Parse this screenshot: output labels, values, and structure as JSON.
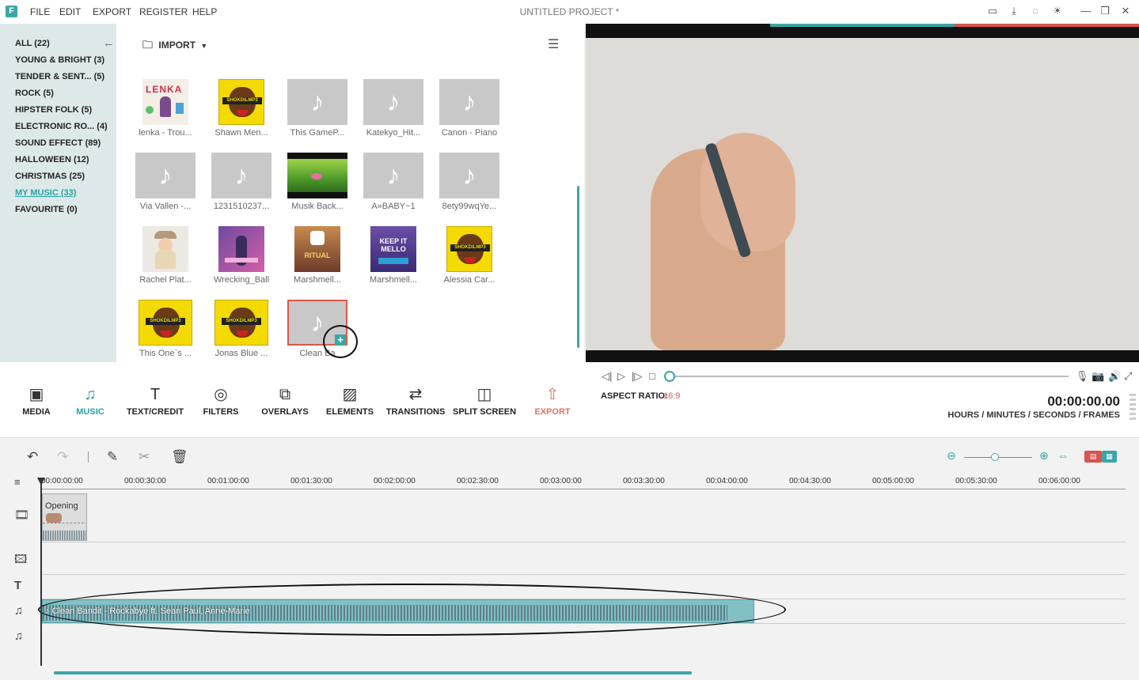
{
  "app": {
    "logo": "F",
    "project_title": "UNTITLED PROJECT *",
    "menu": [
      "FILE",
      "EDIT",
      "EXPORT",
      "REGISTER",
      "HELP"
    ],
    "window_icons": [
      "save-icon",
      "download-icon",
      "feedback-icon",
      "brightness-icon",
      "minimize-icon",
      "restore-icon",
      "close-icon"
    ]
  },
  "categories": [
    {
      "label": "ALL (22)"
    },
    {
      "label": "YOUNG & BRIGHT (3)"
    },
    {
      "label": "TENDER & SENT...  (5)"
    },
    {
      "label": "ROCK (5)"
    },
    {
      "label": "HIPSTER FOLK (5)"
    },
    {
      "label": "ELECTRONIC RO...  (4)"
    },
    {
      "label": "SOUND EFFECT (89)"
    },
    {
      "label": "HALLOWEEN (12)"
    },
    {
      "label": "CHRISTMAS (25)"
    },
    {
      "label": "MY MUSIC (33)",
      "active": true
    },
    {
      "label": "FAVOURITE (0)"
    }
  ],
  "library": {
    "import_label": "IMPORT",
    "items": [
      {
        "caption": "lenka - Trou...",
        "thumb": "lenka"
      },
      {
        "caption": "Shawn Men...",
        "thumb": "bear"
      },
      {
        "caption": "This GameP...",
        "thumb": "note"
      },
      {
        "caption": "Katekyo_Hit...",
        "thumb": "note"
      },
      {
        "caption": "Canon - Piano",
        "thumb": "note"
      },
      {
        "caption": "Via Vallen -...",
        "thumb": "note"
      },
      {
        "caption": "1231510237...",
        "thumb": "note"
      },
      {
        "caption": "Musik Back...",
        "thumb": "nature"
      },
      {
        "caption": "A»BABY~1",
        "thumb": "note"
      },
      {
        "caption": "8ety99wqYe...",
        "thumb": "note"
      },
      {
        "caption": "Rachel Plat...",
        "thumb": "rachel"
      },
      {
        "caption": "Wrecking_Ball",
        "thumb": "wrecking"
      },
      {
        "caption": "Marshmell...",
        "thumb": "ritual"
      },
      {
        "caption": "Marshmell...",
        "thumb": "keepit"
      },
      {
        "caption": "Alessia Car...",
        "thumb": "bear"
      },
      {
        "caption": "This One`s ...",
        "thumb": "bear"
      },
      {
        "caption": "Jonas Blue ...",
        "thumb": "bear"
      },
      {
        "caption": "Clean Ba",
        "thumb": "note",
        "selected": true
      }
    ],
    "bear_text": "SHOKDILMP3",
    "ritual_text": "RITUAL",
    "keepit_text": "KEEP IT MELLO",
    "lenka_text": "LENKA",
    "add_badge": "+"
  },
  "player": {
    "aspect_label": "ASPECT RATIO:",
    "aspect_value": "16:9",
    "timecode": "00:00:00.00",
    "timecode_label": "HOURS / MINUTES / SECONDS / FRAMES",
    "progress": 0
  },
  "toolbar": [
    {
      "label": "MEDIA",
      "icon": "media-icon"
    },
    {
      "label": "MUSIC",
      "icon": "music-icon",
      "active": true
    },
    {
      "label": "TEXT/CREDIT",
      "icon": "text-icon"
    },
    {
      "label": "FILTERS",
      "icon": "filters-icon"
    },
    {
      "label": "OVERLAYS",
      "icon": "overlays-icon"
    },
    {
      "label": "ELEMENTS",
      "icon": "elements-icon"
    },
    {
      "label": "TRANSITIONS",
      "icon": "transitions-icon"
    },
    {
      "label": "SPLIT SCREEN",
      "icon": "split-screen-icon"
    },
    {
      "label": "EXPORT",
      "icon": "export-icon"
    }
  ],
  "timeline": {
    "ruler": [
      "00:00:00:00",
      "00:00:30:00",
      "00:01:00:00",
      "00:01:30:00",
      "00:02:00:00",
      "00:02:30:00",
      "00:03:00:00",
      "00:03:30:00",
      "00:04:00:00",
      "00:04:30:00",
      "00:05:00:00",
      "00:05:30:00",
      "00:06:00:00"
    ],
    "video_clip": "Opening",
    "audio_clip": "Clean Bandit - Rockabye ft. Sean Paul, Anne-Marie",
    "zoom_level": 0.45
  },
  "colors": {
    "accent": "#3aa6a6",
    "export": "#e07060",
    "selection": "#e0564a"
  }
}
